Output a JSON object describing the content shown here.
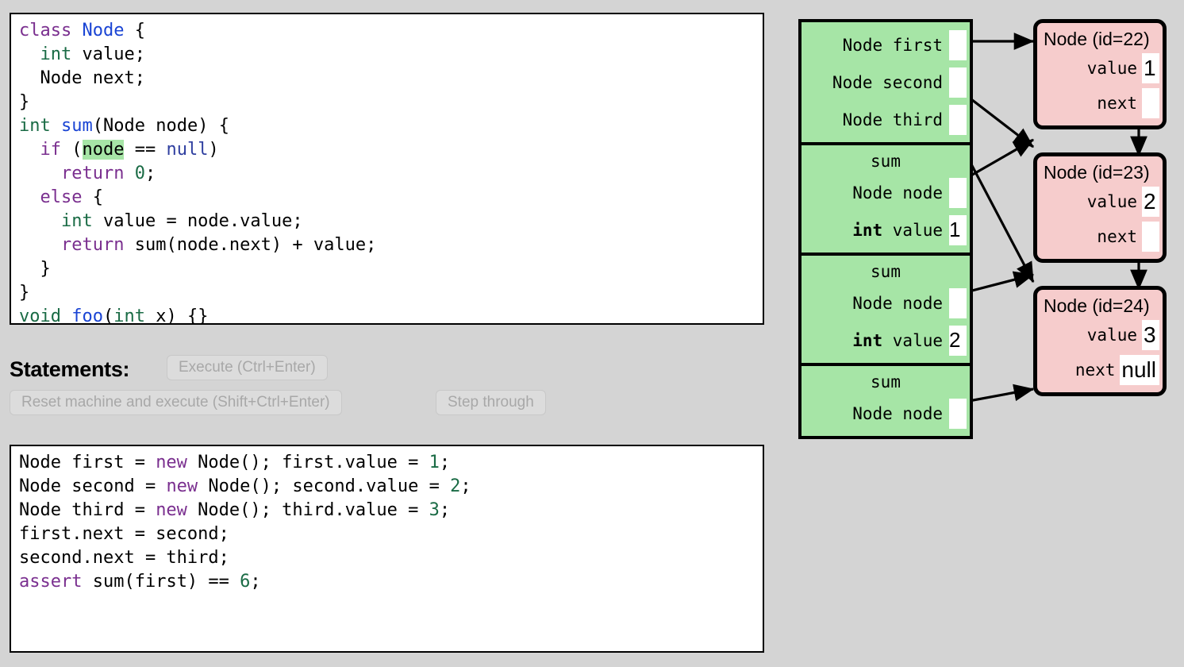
{
  "editor": {
    "name": "class-definitions-editor",
    "lines": [
      [
        {
          "t": "class ",
          "c": "kw"
        },
        {
          "t": "Node",
          "c": "ident"
        },
        {
          "t": " {",
          "c": "plain"
        }
      ],
      [
        {
          "t": "  ",
          "c": "plain"
        },
        {
          "t": "int",
          "c": "type"
        },
        {
          "t": " value;",
          "c": "plain"
        }
      ],
      [
        {
          "t": "  Node next;",
          "c": "plain"
        }
      ],
      [
        {
          "t": "}",
          "c": "plain"
        }
      ],
      [
        {
          "t": "int",
          "c": "type"
        },
        {
          "t": " ",
          "c": "plain"
        },
        {
          "t": "sum",
          "c": "ident"
        },
        {
          "t": "(Node node) {",
          "c": "plain"
        }
      ],
      [
        {
          "t": "  ",
          "c": "plain"
        },
        {
          "t": "if",
          "c": "kw"
        },
        {
          "t": " (",
          "c": "plain"
        },
        {
          "t": "node",
          "c": "plain hl"
        },
        {
          "t": " == ",
          "c": "plain"
        },
        {
          "t": "null",
          "c": "nullkw"
        },
        {
          "t": ")",
          "c": "plain"
        }
      ],
      [
        {
          "t": "    ",
          "c": "plain"
        },
        {
          "t": "return",
          "c": "kw"
        },
        {
          "t": " ",
          "c": "plain"
        },
        {
          "t": "0",
          "c": "num"
        },
        {
          "t": ";",
          "c": "plain"
        }
      ],
      [
        {
          "t": "  ",
          "c": "plain"
        },
        {
          "t": "else",
          "c": "kw"
        },
        {
          "t": " {",
          "c": "plain"
        }
      ],
      [
        {
          "t": "    ",
          "c": "plain"
        },
        {
          "t": "int",
          "c": "type"
        },
        {
          "t": " value = node.value;",
          "c": "plain"
        }
      ],
      [
        {
          "t": "    ",
          "c": "plain"
        },
        {
          "t": "return",
          "c": "kw"
        },
        {
          "t": " sum(node.next) + value;",
          "c": "plain"
        }
      ],
      [
        {
          "t": "  }",
          "c": "plain"
        }
      ],
      [
        {
          "t": "}",
          "c": "plain"
        }
      ],
      [
        {
          "t": "void",
          "c": "type"
        },
        {
          "t": " ",
          "c": "plain"
        },
        {
          "t": "foo",
          "c": "ident"
        },
        {
          "t": "(",
          "c": "plain"
        },
        {
          "t": "int",
          "c": "type"
        },
        {
          "t": " x) {}",
          "c": "plain"
        }
      ]
    ]
  },
  "statements_bar": {
    "label": "Statements:",
    "execute_label": "Execute (Ctrl+Enter)",
    "reset_label": "Reset machine and execute (Shift+Ctrl+Enter)",
    "step_label": "Step through",
    "buttons_disabled": true
  },
  "statements_editor": {
    "name": "statements-editor",
    "lines": [
      [
        {
          "t": "Node first = ",
          "c": "plain"
        },
        {
          "t": "new",
          "c": "kw"
        },
        {
          "t": " Node(); first.value = ",
          "c": "plain"
        },
        {
          "t": "1",
          "c": "num"
        },
        {
          "t": ";",
          "c": "plain"
        }
      ],
      [
        {
          "t": "Node second = ",
          "c": "plain"
        },
        {
          "t": "new",
          "c": "kw"
        },
        {
          "t": " Node(); second.value = ",
          "c": "plain"
        },
        {
          "t": "2",
          "c": "num"
        },
        {
          "t": ";",
          "c": "plain"
        }
      ],
      [
        {
          "t": "Node third = ",
          "c": "plain"
        },
        {
          "t": "new",
          "c": "kw"
        },
        {
          "t": " Node(); third.value = ",
          "c": "plain"
        },
        {
          "t": "3",
          "c": "num"
        },
        {
          "t": ";",
          "c": "plain"
        }
      ],
      [
        {
          "t": "first.next = second;",
          "c": "plain"
        }
      ],
      [
        {
          "t": "second.next = third;",
          "c": "plain"
        }
      ],
      [
        {
          "t": "assert",
          "c": "kw"
        },
        {
          "t": " sum(first) == ",
          "c": "plain"
        },
        {
          "t": "6",
          "c": "num"
        },
        {
          "t": ";",
          "c": "plain"
        }
      ]
    ]
  },
  "machine": {
    "stack": {
      "frames": [
        {
          "title": "",
          "show_title": false,
          "vars": [
            {
              "type": "Node",
              "name": "first",
              "value": "",
              "bold_type": false
            },
            {
              "type": "Node",
              "name": "second",
              "value": "",
              "bold_type": false
            },
            {
              "type": "Node",
              "name": "third",
              "value": "",
              "bold_type": false
            }
          ]
        },
        {
          "title": "sum",
          "show_title": true,
          "vars": [
            {
              "type": "Node",
              "name": "node",
              "value": "",
              "bold_type": false
            },
            {
              "type": "int",
              "name": "value",
              "value": "1",
              "bold_type": true
            }
          ]
        },
        {
          "title": "sum",
          "show_title": true,
          "vars": [
            {
              "type": "Node",
              "name": "node",
              "value": "",
              "bold_type": false
            },
            {
              "type": "int",
              "name": "value",
              "value": "2",
              "bold_type": true
            }
          ]
        },
        {
          "title": "sum",
          "show_title": true,
          "vars": [
            {
              "type": "Node",
              "name": "node",
              "value": "",
              "bold_type": false
            }
          ]
        }
      ]
    },
    "heap": [
      {
        "title": "Node (id=22)",
        "fields": [
          {
            "name": "value",
            "value": "1"
          },
          {
            "name": "next",
            "value": ""
          }
        ]
      },
      {
        "title": "Node (id=23)",
        "fields": [
          {
            "name": "value",
            "value": "2"
          },
          {
            "name": "next",
            "value": ""
          }
        ]
      },
      {
        "title": "Node (id=24)",
        "fields": [
          {
            "name": "value",
            "value": "3"
          },
          {
            "name": "next",
            "value": "null"
          }
        ]
      }
    ]
  },
  "colors": {
    "page_background": "#d4d4d4",
    "stack_frame": "#a6e5a6",
    "heap_object": "#f6cccc",
    "slot": "#ffffff",
    "outline": "#000000",
    "keyword": "#7a2f8f",
    "type": "#1a6b45",
    "identifier": "#1a44d4",
    "highlight": "#a6e5a6"
  }
}
